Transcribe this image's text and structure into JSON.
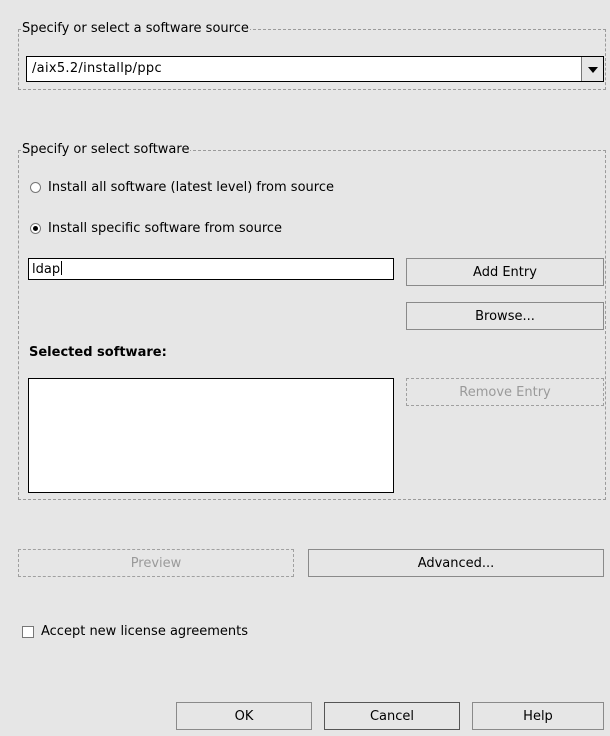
{
  "source_group": {
    "legend": "Specify or select a software source",
    "combo_value": "/aix5.2/installp/ppc"
  },
  "software_group": {
    "legend": "Specify or select software",
    "radio_all_label": "Install all software (latest level) from source",
    "radio_specific_label": "Install specific software from source",
    "selected_radio": "specific",
    "entry_value": "ldap",
    "add_entry_label": "Add Entry",
    "browse_label": "Browse...",
    "selected_software_label": "Selected software:",
    "selected_software_items": [],
    "remove_entry_label": "Remove Entry"
  },
  "actions": {
    "preview_label": "Preview",
    "advanced_label": "Advanced..."
  },
  "license": {
    "label": "Accept new license agreements",
    "checked": false
  },
  "footer": {
    "ok_label": "OK",
    "cancel_label": "Cancel",
    "help_label": "Help"
  }
}
